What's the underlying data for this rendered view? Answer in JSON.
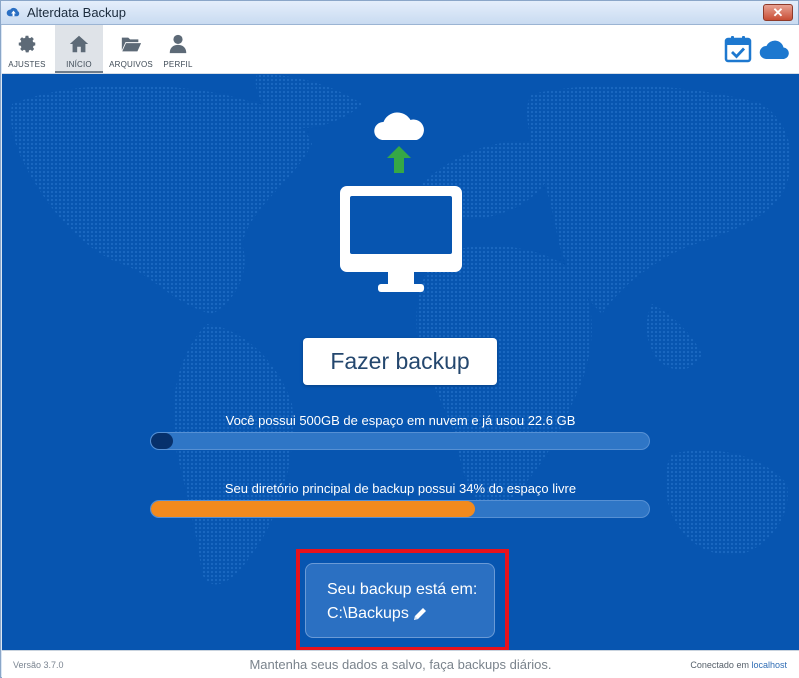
{
  "window": {
    "title": "Alterdata Backup",
    "close_label": "✕"
  },
  "toolbar": {
    "items": [
      {
        "label": "AJUSTES",
        "icon": "gear-icon"
      },
      {
        "label": "INÍCIO",
        "icon": "home-icon",
        "active": true
      },
      {
        "label": "ARQUIVOS",
        "icon": "folder-icon"
      },
      {
        "label": "PERFIL",
        "icon": "user-icon"
      }
    ],
    "right_icons": [
      "calendar-check-icon",
      "cloud-icon"
    ]
  },
  "main": {
    "backup_button": "Fazer backup",
    "cloud_usage_text": "Você possui 500GB de espaço em nuvem e já usou 22.6 GB",
    "cloud_usage_fraction": 0.045,
    "disk_text": "Seu diretório principal de backup possui 34% do espaço livre",
    "disk_bar_fraction": 0.65,
    "location": {
      "title": "Seu backup está em:",
      "path": "C:\\Backups"
    }
  },
  "status": {
    "version": "Versão 3.7.0",
    "slogan": "Mantenha seus dados a salvo, faça backups diários.",
    "connected_prefix": "Conectado em",
    "host": "localhost"
  },
  "colors": {
    "primary": "#0755b0",
    "accent": "#f28a1d",
    "highlight": "#e8121b",
    "arrow": "#35a845"
  }
}
